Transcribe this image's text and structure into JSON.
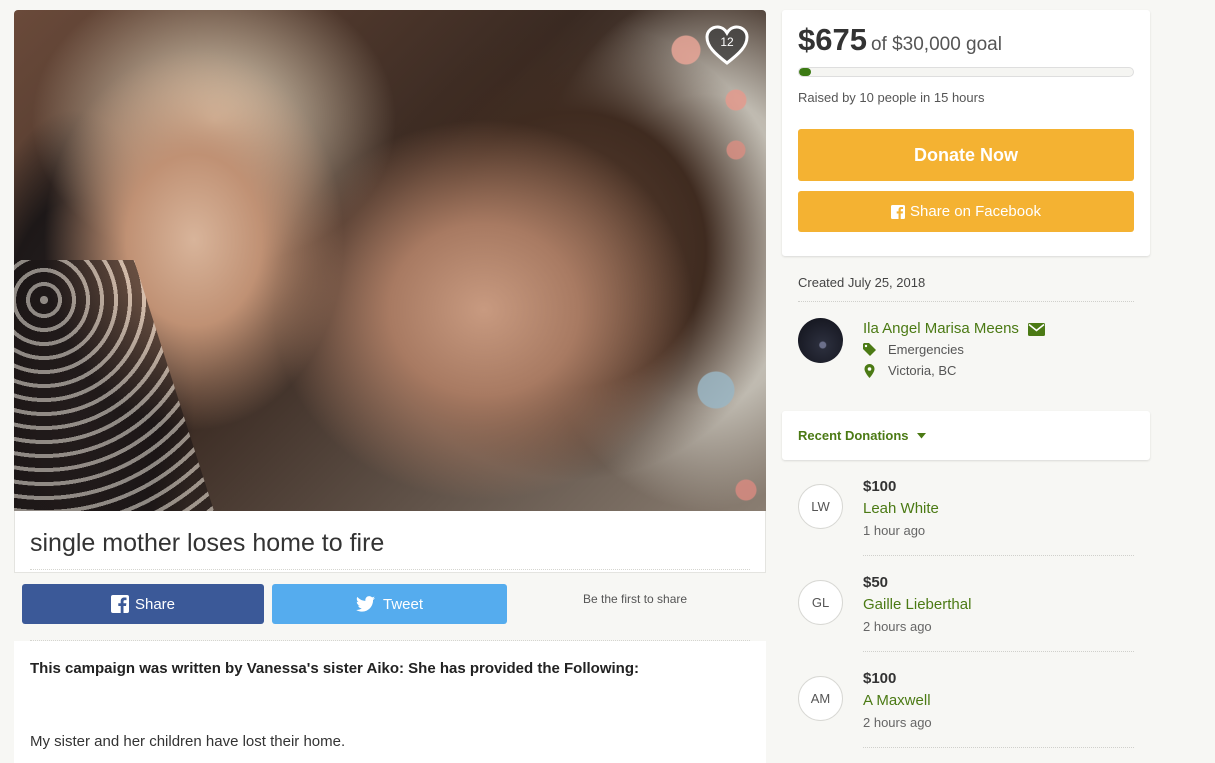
{
  "campaign": {
    "heart_count": "12",
    "title": "single mother loses home to fire",
    "share": {
      "facebook_label": "Share",
      "tweet_label": "Tweet",
      "hint": "Be the first to share"
    },
    "story": {
      "intro": "This campaign was written by Vanessa's sister Aiko: She has provided the Following:",
      "first_line": "My sister and her children have lost their home."
    }
  },
  "goal": {
    "amount": "$675",
    "goal_text": "of $30,000 goal",
    "progress_fraction": 0.0225,
    "raised_text": "Raised by 10 people in 15 hours",
    "donate_label": "Donate Now",
    "fb_share_label": "Share on Facebook"
  },
  "meta": {
    "created": "Created July 25, 2018",
    "organizer": "Ila Angel Marisa Meens",
    "category": "Emergencies",
    "location": "Victoria, BC"
  },
  "recent": {
    "label": "Recent Donations",
    "donations": [
      {
        "initials": "LW",
        "amount": "$100",
        "name": "Leah White",
        "time": "1 hour ago"
      },
      {
        "initials": "GL",
        "amount": "$50",
        "name": "Gaille Lieberthal",
        "time": "2 hours ago"
      },
      {
        "initials": "AM",
        "amount": "$100",
        "name": "A Maxwell",
        "time": "2 hours ago"
      }
    ]
  },
  "colors": {
    "accent_green": "#4b7a14",
    "donate_yellow": "#f4b232",
    "facebook_blue": "#3b5998",
    "twitter_blue": "#55acee"
  },
  "icons": [
    "heart-icon",
    "facebook-icon",
    "twitter-icon",
    "mail-icon",
    "tag-icon",
    "map-pin-icon",
    "caret-down-icon"
  ]
}
